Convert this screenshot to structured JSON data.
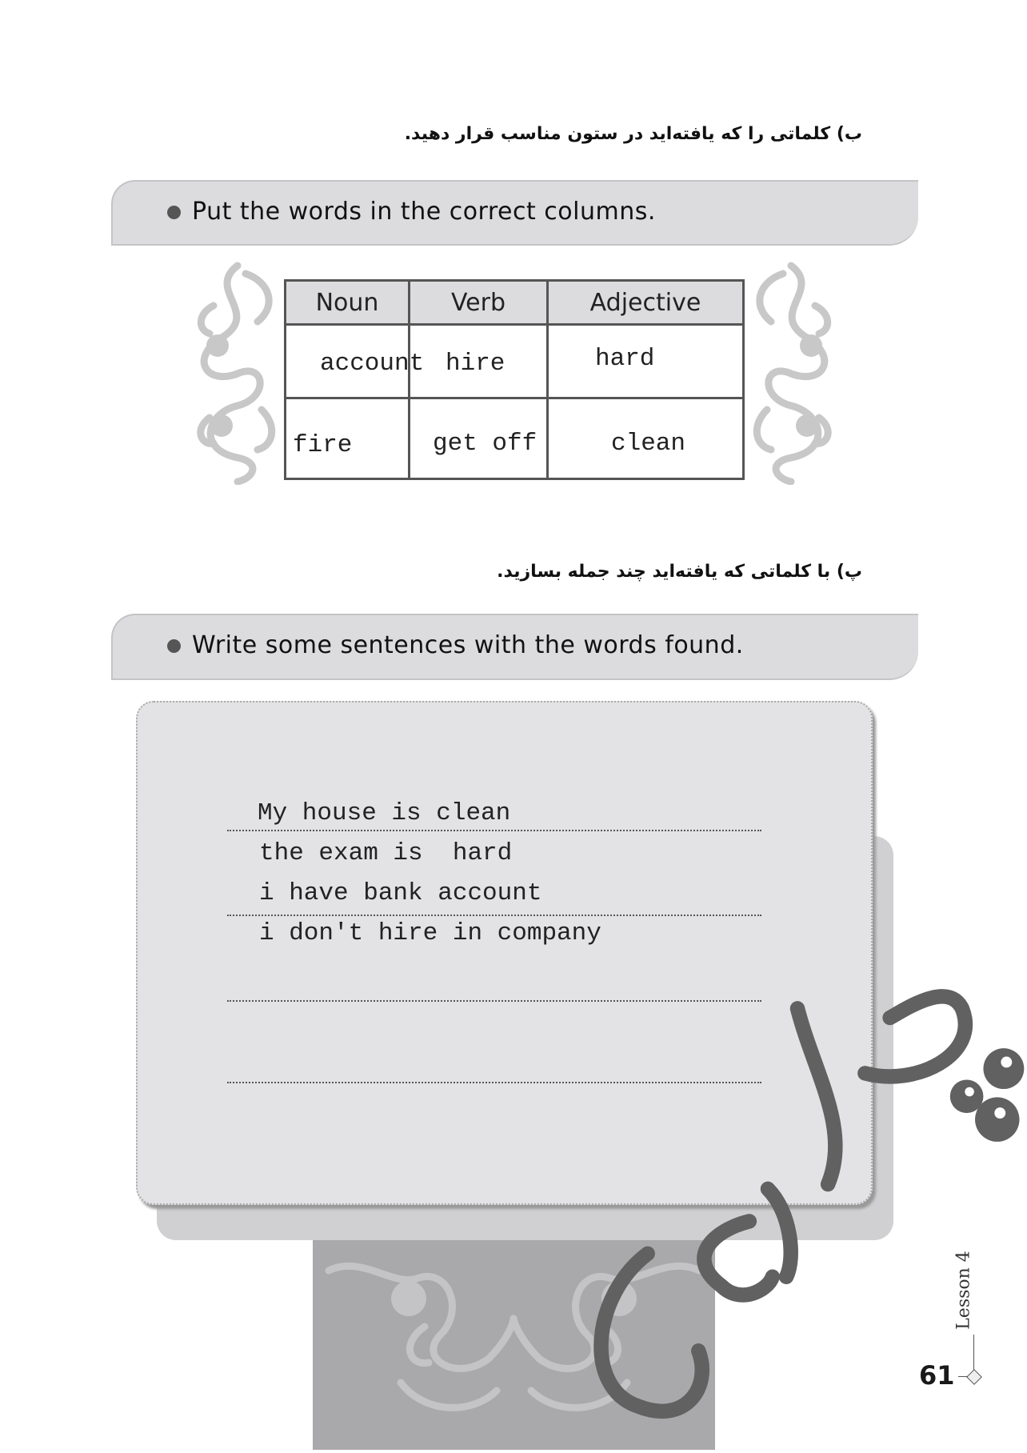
{
  "section_b": {
    "persian_instruction": "ب) کلماتی را که یافته‌اید در ستون مناسب قرار دهید.",
    "instruction": "Put the words in the correct columns.",
    "table": {
      "headers": [
        "Noun",
        "Verb",
        "Adjective"
      ],
      "rows": [
        [
          "account",
          "hire",
          "hard"
        ],
        [
          "fire",
          "get off",
          "clean"
        ]
      ]
    }
  },
  "section_p": {
    "persian_instruction": "پ) با کلماتی که یافته‌اید چند جمله بسازید.",
    "instruction": "Write some sentences with the words found.",
    "sentences": [
      "My house is clean",
      "the exam is  hard",
      "i have bank account",
      "i don't hire in company"
    ]
  },
  "footer": {
    "lesson": "Lesson 4",
    "page_number": "61"
  },
  "watermark": {
    "logo_text": "پادرس",
    "color": "#616161"
  },
  "colors": {
    "banner": "#dcdcde",
    "panel": "#e3e3e5",
    "ornament": "#c8c8c8",
    "ornament_block": "#a9a9ab"
  }
}
